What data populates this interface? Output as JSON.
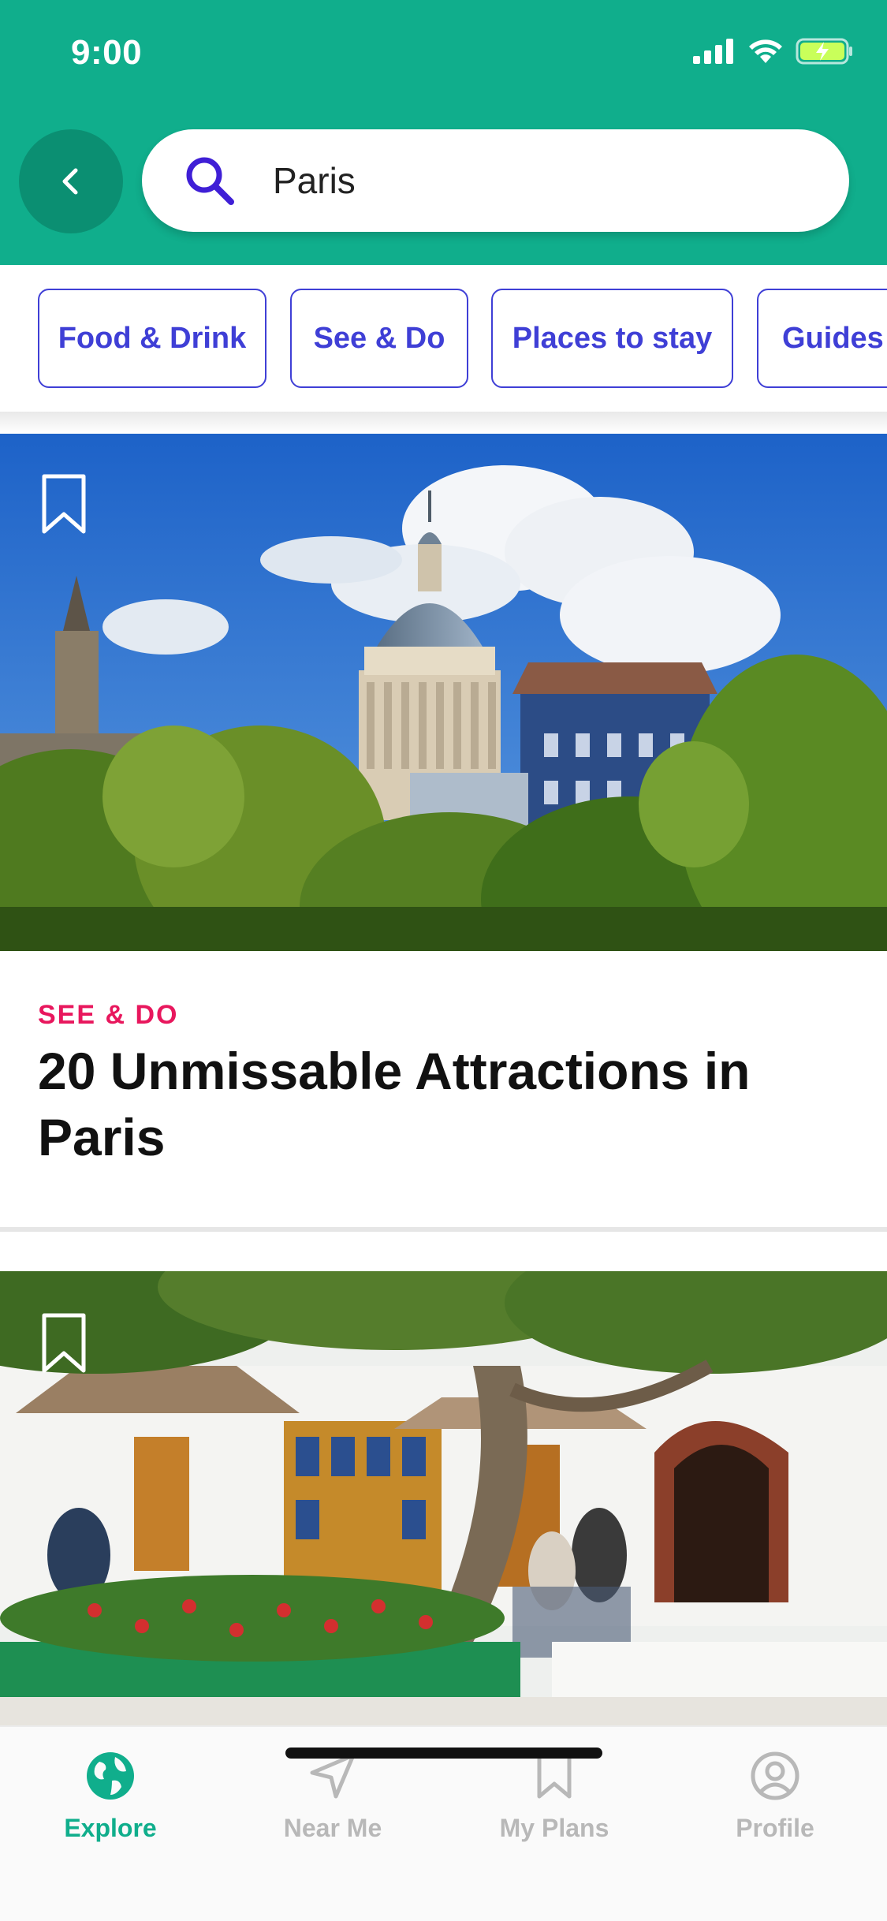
{
  "status_bar": {
    "time": "9:00"
  },
  "search": {
    "value": "Paris",
    "placeholder": "Search"
  },
  "categories": [
    {
      "label": "Food & Drink"
    },
    {
      "label": "See & Do"
    },
    {
      "label": "Places to stay"
    },
    {
      "label": "Guides"
    }
  ],
  "cards": [
    {
      "category": "SEE & DO",
      "title": "20 Unmissable Attractions in Paris"
    },
    {
      "category": "",
      "title": ""
    }
  ],
  "bottom_nav": {
    "items": [
      {
        "label": "Explore",
        "icon": "globe-icon",
        "active": true
      },
      {
        "label": "Near Me",
        "icon": "navigation-arrow-icon",
        "active": false
      },
      {
        "label": "My Plans",
        "icon": "bookmark-icon",
        "active": false
      },
      {
        "label": "Profile",
        "icon": "user-circle-icon",
        "active": false
      }
    ]
  },
  "colors": {
    "brand_green": "#10ae8c",
    "accent_purple": "#3f3fd6",
    "category_red": "#e8175d"
  }
}
